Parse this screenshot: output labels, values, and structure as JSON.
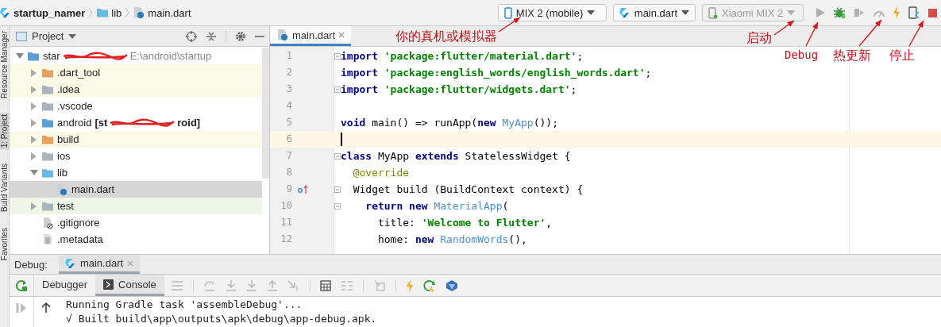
{
  "breadcrumb": [
    {
      "label": "startup_namer",
      "kind": "project"
    },
    {
      "label": "lib",
      "kind": "folder"
    },
    {
      "label": "main.dart",
      "kind": "dart_file"
    }
  ],
  "toolbar": {
    "device": "MIX 2 (mobile)",
    "run_config": "main.dart",
    "target": {
      "label": "Xiaomi MIX 2",
      "disabled": true
    },
    "actions": [
      {
        "kind": "run",
        "disabled": true
      },
      {
        "kind": "debug",
        "disabled": false
      },
      {
        "kind": "attach",
        "disabled": true
      },
      {
        "kind": "profile",
        "disabled": true
      },
      {
        "kind": "hot_reload",
        "disabled": false
      },
      {
        "kind": "inspector",
        "disabled": false
      },
      {
        "kind": "stop",
        "disabled": false
      }
    ]
  },
  "side_strip": [
    {
      "label": "Resource Manager",
      "selected": false
    },
    {
      "label": "1: Project",
      "selected": true
    },
    {
      "label": "Build Variants",
      "selected": false
    },
    {
      "label": "Favorites",
      "selected": false
    }
  ],
  "project_panel": {
    "title": "Project",
    "tree": [
      {
        "label": "star",
        "kind": "folder",
        "color": "#5a9fd6",
        "excluded": false,
        "test": false,
        "redacted": true,
        "path": "E:\\android\\startup",
        "expanded": true,
        "selected": false,
        "children": [
          {
            "label": ".dart_tool",
            "kind": "folder",
            "color": "#e8a060",
            "excluded": true,
            "test": false,
            "expanded": false,
            "selected": false
          },
          {
            "label": ".idea",
            "kind": "folder",
            "color": "#a8b4c0",
            "excluded": true,
            "test": false,
            "expanded": false,
            "selected": false
          },
          {
            "label": ".vscode",
            "kind": "folder",
            "color": "#a8b4c0",
            "excluded": false,
            "test": false,
            "expanded": false,
            "selected": false
          },
          {
            "label": "android",
            "kind": "folder",
            "color": "#5a9fd6",
            "excluded": false,
            "test": false,
            "extra": "[st",
            "redacted": true,
            "extra_tail": "roid]",
            "expanded": false,
            "selected": false
          },
          {
            "label": "build",
            "kind": "folder",
            "color": "#e8a060",
            "excluded": true,
            "test": false,
            "expanded": false,
            "selected": false
          },
          {
            "label": "ios",
            "kind": "folder",
            "color": "#a8b4c0",
            "excluded": false,
            "test": false,
            "expanded": false,
            "selected": false
          },
          {
            "label": "lib",
            "kind": "folder",
            "color": "#6bb8e0",
            "excluded": false,
            "test": false,
            "expanded": true,
            "selected": false,
            "children": [
              {
                "label": "main.dart",
                "kind": "dart_file",
                "excluded": false,
                "test": false,
                "selected": true
              }
            ]
          },
          {
            "label": "test",
            "kind": "folder",
            "color": "#a8b4c0",
            "excluded": false,
            "test": true,
            "expanded": false,
            "selected": false
          },
          {
            "label": ".gitignore",
            "kind": "gitignore_file",
            "excluded": false,
            "test": false,
            "selected": false
          },
          {
            "label": ".metadata",
            "kind": "text_file",
            "excluded": false,
            "test": false,
            "selected": false
          }
        ]
      }
    ]
  },
  "editor": {
    "tabs": [
      {
        "label": "main.dart",
        "selected": true
      }
    ],
    "lines": [
      {
        "number": "1",
        "fold": true,
        "current": false,
        "tokens": [
          {
            "kind": "keyword",
            "text": "import "
          },
          {
            "kind": "string",
            "text": "'package:flutter/material.dart'"
          },
          {
            "kind": "plain",
            "text": ";"
          }
        ]
      },
      {
        "number": "2",
        "fold": false,
        "current": false,
        "tokens": [
          {
            "kind": "keyword",
            "text": "import "
          },
          {
            "kind": "string",
            "text": "'package:english_words/english_words.dart'"
          },
          {
            "kind": "plain",
            "text": ";"
          }
        ]
      },
      {
        "number": "3",
        "fold": true,
        "current": false,
        "tokens": [
          {
            "kind": "keyword",
            "text": "import "
          },
          {
            "kind": "string",
            "text": "'package:flutter/widgets.dart'"
          },
          {
            "kind": "plain",
            "text": ";"
          }
        ]
      },
      {
        "number": "4",
        "fold": false,
        "current": false
      },
      {
        "number": "5",
        "fold": false,
        "current": false,
        "tokens": [
          {
            "kind": "keyword",
            "text": "void "
          },
          {
            "kind": "plain",
            "text": "main() => runApp("
          },
          {
            "kind": "keyword",
            "text": "new "
          },
          {
            "kind": "type",
            "text": "MyApp"
          },
          {
            "kind": "plain",
            "text": "());"
          }
        ]
      },
      {
        "number": "6",
        "fold": false,
        "current": true
      },
      {
        "number": "7",
        "fold": true,
        "current": false,
        "tokens": [
          {
            "kind": "keyword",
            "text": "class "
          },
          {
            "kind": "plain",
            "text": "MyApp "
          },
          {
            "kind": "keyword",
            "text": "extends "
          },
          {
            "kind": "plain",
            "text": "StatelessWidget {"
          }
        ]
      },
      {
        "number": "8",
        "fold": false,
        "current": false,
        "tokens": [
          {
            "kind": "annotation",
            "text": "  @override"
          }
        ]
      },
      {
        "number": "9",
        "fold": true,
        "current": false,
        "overrides": true,
        "tokens": [
          {
            "kind": "plain",
            "text": "  Widget build (BuildContext context) {"
          }
        ]
      },
      {
        "number": "10",
        "fold": true,
        "current": false,
        "tokens": [
          {
            "kind": "keyword",
            "text": "    return new "
          },
          {
            "kind": "type",
            "text": "MaterialApp"
          },
          {
            "kind": "plain",
            "text": "("
          }
        ]
      },
      {
        "number": "11",
        "fold": false,
        "current": false,
        "tokens": [
          {
            "kind": "plain",
            "text": "      title: "
          },
          {
            "kind": "string",
            "text": "'Welcome to Flutter'"
          },
          {
            "kind": "plain",
            "text": ","
          }
        ]
      },
      {
        "number": "12",
        "fold": false,
        "current": false,
        "tokens": [
          {
            "kind": "plain",
            "text": "      home: "
          },
          {
            "kind": "keyword",
            "text": "new "
          },
          {
            "kind": "type",
            "text": "RandomWords"
          },
          {
            "kind": "plain",
            "text": "(),"
          }
        ]
      }
    ]
  },
  "debug": {
    "title": "Debug:",
    "session_tab": "main.dart",
    "tabs": [
      {
        "label": "Debugger",
        "selected": false
      },
      {
        "label": "Console",
        "selected": true
      }
    ],
    "tools": [
      {
        "kind": "list",
        "disabled": true
      },
      {
        "kind": "step_over",
        "disabled": true
      },
      {
        "kind": "step_into",
        "disabled": true
      },
      {
        "kind": "step_into",
        "disabled": true
      },
      {
        "kind": "step_out",
        "disabled": true
      },
      {
        "kind": "run_to_cursor",
        "disabled": true
      },
      {
        "kind": "evaluate",
        "disabled": false
      },
      {
        "kind": "trace",
        "disabled": true
      },
      {
        "kind": "restore",
        "disabled": true
      },
      {
        "kind": "hot_reload",
        "disabled": false
      },
      {
        "kind": "hot_restart",
        "disabled": false
      },
      {
        "kind": "devtools",
        "disabled": false
      }
    ],
    "console": [
      "Running Gradle task 'assembleDebug'...",
      "√ Built build\\app\\outputs\\apk\\debug\\app-debug.apk."
    ]
  },
  "annotations": [
    {
      "text": "你的真机或模拟器"
    },
    {
      "text": "启动"
    },
    {
      "text": "Debug"
    },
    {
      "text": "热更新"
    },
    {
      "text": "停止"
    }
  ]
}
